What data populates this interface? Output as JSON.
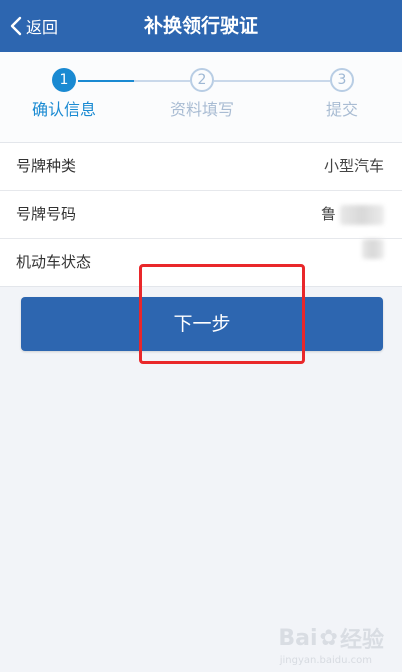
{
  "header": {
    "back_label": "返回",
    "title": "补换领行驶证"
  },
  "steps": [
    {
      "number": "1",
      "label": "确认信息",
      "state": "active"
    },
    {
      "number": "2",
      "label": "资料填写",
      "state": "inactive"
    },
    {
      "number": "3",
      "label": "提交",
      "state": "inactive"
    }
  ],
  "info_rows": [
    {
      "label": "号牌种类",
      "value": "小型汽车"
    },
    {
      "label": "号牌号码",
      "value": "鲁"
    },
    {
      "label": "机动车状态",
      "value": ""
    }
  ],
  "next_button": {
    "label": "下一步"
  },
  "watermark": {
    "text_a": "Bai",
    "text_b": "经验",
    "sub": "jingyan.baidu.com"
  },
  "colors": {
    "nav": "#2d66b0",
    "accent": "#1a8ad2",
    "highlight": "#e9272a",
    "background": "#f2f4f8"
  }
}
